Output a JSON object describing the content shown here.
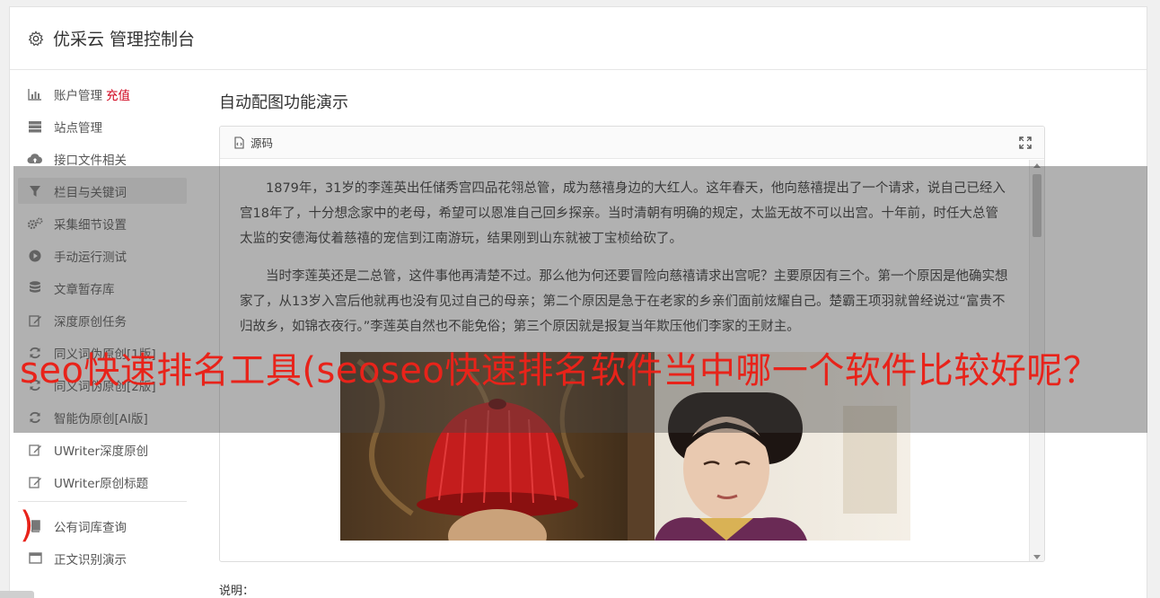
{
  "header": {
    "title": "优采云 管理控制台"
  },
  "sidebar": {
    "items": [
      {
        "label": "账户管理",
        "badge": "充值",
        "icon": "bar-chart-icon"
      },
      {
        "label": "站点管理",
        "icon": "server-icon"
      },
      {
        "label": "接口文件相关",
        "icon": "cloud-upload-icon"
      },
      {
        "label": "栏目与关键词",
        "icon": "filter-icon",
        "active": true
      },
      {
        "label": "采集细节设置",
        "icon": "cogs-icon"
      },
      {
        "label": "手动运行测试",
        "icon": "play-circle-icon"
      },
      {
        "label": "文章暂存库",
        "icon": "database-icon"
      },
      {
        "label": "深度原创任务",
        "icon": "edit-icon"
      },
      {
        "label": "同义词伪原创[1版]",
        "icon": "refresh-icon"
      },
      {
        "label": "同义词伪原创[2版]",
        "icon": "refresh-icon"
      },
      {
        "label": "智能伪原创[AI版]",
        "icon": "refresh-icon"
      },
      {
        "label": "UWriter深度原创",
        "icon": "edit-icon"
      },
      {
        "label": "UWriter原创标题",
        "icon": "edit-icon"
      },
      {
        "label": "公有词库查询",
        "icon": "book-icon"
      },
      {
        "label": "正文识别演示",
        "icon": "window-icon"
      }
    ]
  },
  "main": {
    "title": "自动配图功能演示",
    "toolbar": {
      "source_label": "源码"
    },
    "paragraphs": [
      "1879年，31岁的李莲英出任储秀宫四品花翎总管，成为慈禧身边的大红人。这年春天，他向慈禧提出了一个请求，说自己已经入宫18年了，十分想念家中的老母，希望可以恩准自己回乡探亲。当时清朝有明确的规定，太监无故不可以出宫。十年前，时任大总管太监的安德海仗着慈禧的宠信到江南游玩，结果刚到山东就被丁宝桢给砍了。",
      "当时李莲英还是二总管，这件事他再清楚不过。那么他为何还要冒险向慈禧请求出宫呢？主要原因有三个。第一个原因是他确实想家了，从13岁入宫后他就再也没有见过自己的母亲；第二个原因是急于在老家的乡亲们面前炫耀自己。楚霸王项羽就曾经说过“富贵不归故乡，如锦衣夜行。”李莲英自然也不能免俗；第三个原因就是报复当年欺压他们李家的王财主。"
    ],
    "desc_label": "说明："
  },
  "overlay": {
    "headline": "seo快速排名工具(seoseo快速排名软件当中哪一个软件比较好呢？",
    "headline_tail": ")"
  },
  "colors": {
    "accent_red": "#d0021b",
    "overlay_text": "#e8231a"
  }
}
